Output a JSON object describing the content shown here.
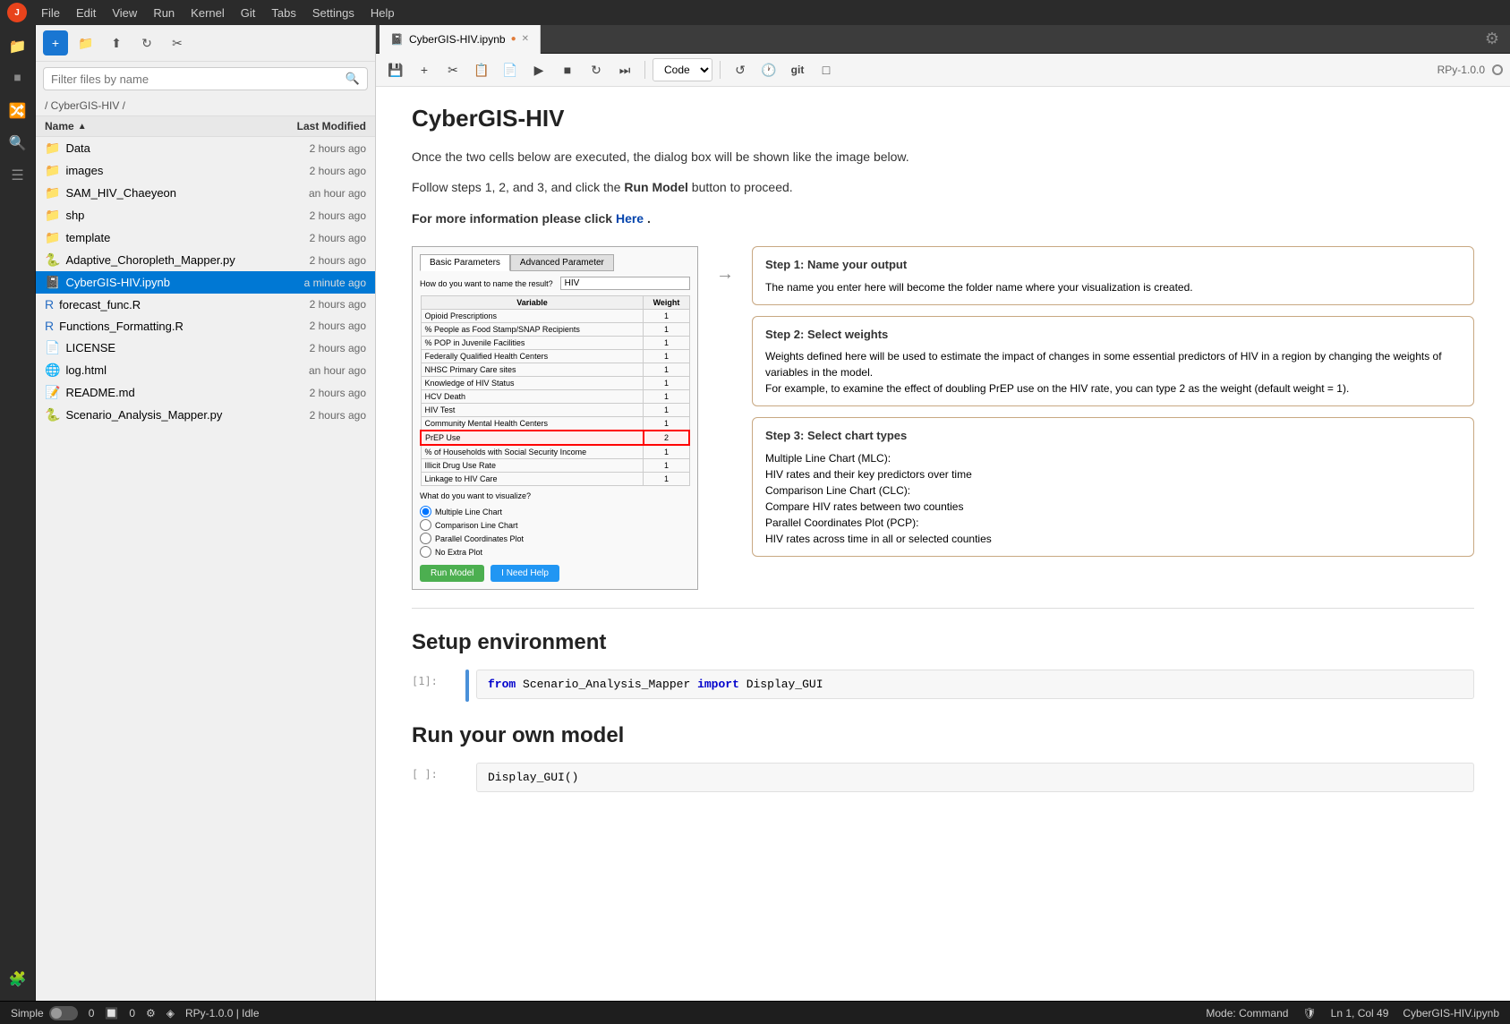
{
  "menubar": {
    "items": [
      "File",
      "Edit",
      "View",
      "Run",
      "Kernel",
      "Git",
      "Tabs",
      "Settings",
      "Help"
    ]
  },
  "file_panel": {
    "search_placeholder": "Filter files by name",
    "breadcrumb": "/ CyberGIS-HIV /",
    "columns": {
      "name": "Name",
      "modified": "Last Modified"
    },
    "files": [
      {
        "name": "Data",
        "type": "folder",
        "modified": "2 hours ago"
      },
      {
        "name": "images",
        "type": "folder",
        "modified": "2 hours ago"
      },
      {
        "name": "SAM_HIV_Chaeyeon",
        "type": "folder",
        "modified": "an hour ago"
      },
      {
        "name": "shp",
        "type": "folder",
        "modified": "2 hours ago"
      },
      {
        "name": "template",
        "type": "folder",
        "modified": "2 hours ago"
      },
      {
        "name": "Adaptive_Choropleth_Mapper.py",
        "type": "py",
        "modified": "2 hours ago"
      },
      {
        "name": "CyberGIS-HIV.ipynb",
        "type": "ipynb",
        "modified": "a minute ago",
        "selected": true
      },
      {
        "name": "forecast_func.R",
        "type": "r",
        "modified": "2 hours ago"
      },
      {
        "name": "Functions_Formatting.R",
        "type": "r",
        "modified": "2 hours ago"
      },
      {
        "name": "LICENSE",
        "type": "file",
        "modified": "2 hours ago"
      },
      {
        "name": "log.html",
        "type": "html",
        "modified": "an hour ago"
      },
      {
        "name": "README.md",
        "type": "md",
        "modified": "2 hours ago"
      },
      {
        "name": "Scenario_Analysis_Mapper.py",
        "type": "py",
        "modified": "2 hours ago"
      }
    ]
  },
  "notebook": {
    "tab_name": "CyberGIS-HIV.ipynb",
    "tab_dirty": true,
    "cell_type": "Code",
    "kernel": "RPy-1.0.0",
    "title": "CyberGIS-HIV",
    "intro_text1": "Once the two cells below are executed, the dialog box will be shown like the image below.",
    "intro_text2": "Follow steps 1, 2, and 3, and click the",
    "intro_bold": "Run Model",
    "intro_text3": "button to proceed.",
    "more_info": "For more information please click",
    "link_text": "Here",
    "link_dot": ".",
    "dialog": {
      "tabs": [
        "Basic Parameters",
        "Advanced Parameter"
      ],
      "active_tab": "Basic Parameters",
      "label_result": "How do you want to name the result?",
      "input_value": "HIV",
      "table_headers": [
        "Variable",
        "Weight"
      ],
      "rows": [
        {
          "label": "Opioid Prescriptions",
          "weight": "1",
          "highlight": false
        },
        {
          "label": "% People as Food Stamp/SNAP Recipients",
          "weight": "1",
          "highlight": false
        },
        {
          "label": "% POP in Juvenile Facilities",
          "weight": "1",
          "highlight": false
        },
        {
          "label": "Federally Qualified Health Centers",
          "weight": "1",
          "highlight": false
        },
        {
          "label": "NHSC Primary Care sites",
          "weight": "1",
          "highlight": false
        },
        {
          "label": "Knowledge of HIV Status",
          "weight": "1",
          "highlight": false
        },
        {
          "label": "HCV Death",
          "weight": "1",
          "highlight": false
        },
        {
          "label": "HIV Test",
          "weight": "1",
          "highlight": false
        },
        {
          "label": "Community Mental Health Centers",
          "weight": "1",
          "highlight": false
        },
        {
          "label": "PrEP Use",
          "weight": "2",
          "highlight": true
        },
        {
          "label": "% of Households with Social Security Income",
          "weight": "1",
          "highlight": false
        },
        {
          "label": "Illicit Drug Use Rate",
          "weight": "1",
          "highlight": false
        },
        {
          "label": "Linkage to HIV Care",
          "weight": "1",
          "highlight": false
        }
      ],
      "visualize_label": "What do you want to visualize?",
      "radio_options": [
        "Multiple Line Chart",
        "Comparison Line Chart",
        "Parallel Coordinates Plot",
        "No Extra Plot"
      ],
      "btn_run": "Run Model",
      "btn_help": "I Need Help"
    },
    "steps": [
      {
        "title": "Step 1: Name your output",
        "text": "The name you enter here will become the folder name where your visualization is created."
      },
      {
        "title": "Step 2: Select weights",
        "text": "Weights defined here will be used to estimate the impact of changes in some essential predictors of HIV in a region by changing the weights of variables in the model.\nFor example, to examine the effect of doubling PrEP use on the HIV rate, you can type 2 as the weight (default weight = 1)."
      },
      {
        "title": "Step 3: Select chart types",
        "text": "Multiple Line Chart (MLC):\n   HIV rates and their key predictors over time\nComparison Line Chart (CLC):\n   Compare HIV rates between two counties\nParallel Coordinates Plot (PCP):\n   HIV rates across time in all or selected counties"
      }
    ],
    "setup_title": "Setup environment",
    "code_cell1_counter": "[1]:",
    "code_cell1": "from Scenario_Analysis_Mapper import Display_GUI",
    "run_title": "Run your own model",
    "code_cell2_counter": "[ ]:",
    "code_cell2": "Display_GUI()"
  },
  "statusbar": {
    "mode": "Simple",
    "numbers": "0",
    "right_items": [
      "Mode: Command",
      "Ln 1, Col 49",
      "CyberGIS-HIV.ipynb"
    ],
    "kernel_label": "RPy-1.0.0 | Idle"
  }
}
